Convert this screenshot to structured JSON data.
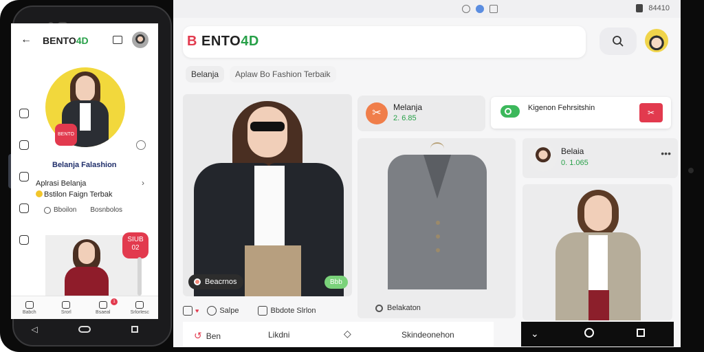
{
  "status_bar": {
    "right_text": "84410"
  },
  "header": {
    "brand_part1": "B",
    "brand_part2": " ENTO",
    "brand_part3": "4D",
    "search_icon": "search-icon"
  },
  "breadcrumb": [
    "Belanja",
    "Aplaw Bo Fashion Terbaik"
  ],
  "main_photo": {
    "tag_left": "Beacrnos",
    "tag_right": "Bbb"
  },
  "action_row": {
    "item2": "Salpe",
    "item3": "Bbdote Slrlon"
  },
  "card_a": {
    "title": "Melanja",
    "value": "2. 6.85"
  },
  "card_b": {
    "text": "Kigenon Fehrsitshin"
  },
  "card_c": {
    "title": "Belaia",
    "value": "0. 1.065"
  },
  "belaka_pill": "Belakaton",
  "bottom_bar": {
    "item1": "Ben",
    "item2": "Likdni",
    "item3": "Skindeonehon"
  },
  "phone": {
    "brand": "BENTO",
    "brand_suffix": "4D",
    "badge_text": "BENTO 4D",
    "title": "Belanja Falashion",
    "row_line1": "Aplrasi Belanja",
    "row_line2": "Bstilon Faign Terbak",
    "action1": "Bboilon",
    "action2": "Bosnbolos",
    "sale_line1": "SIUB",
    "sale_line2": "02",
    "tabs": [
      "Babch",
      "Srorl",
      "Bsaeal",
      "Srlorlesc"
    ],
    "notif_count": "1"
  },
  "colors": {
    "accent_red": "#e23a4e",
    "accent_green": "#27a048",
    "avatar_yellow": "#f2d83c"
  }
}
